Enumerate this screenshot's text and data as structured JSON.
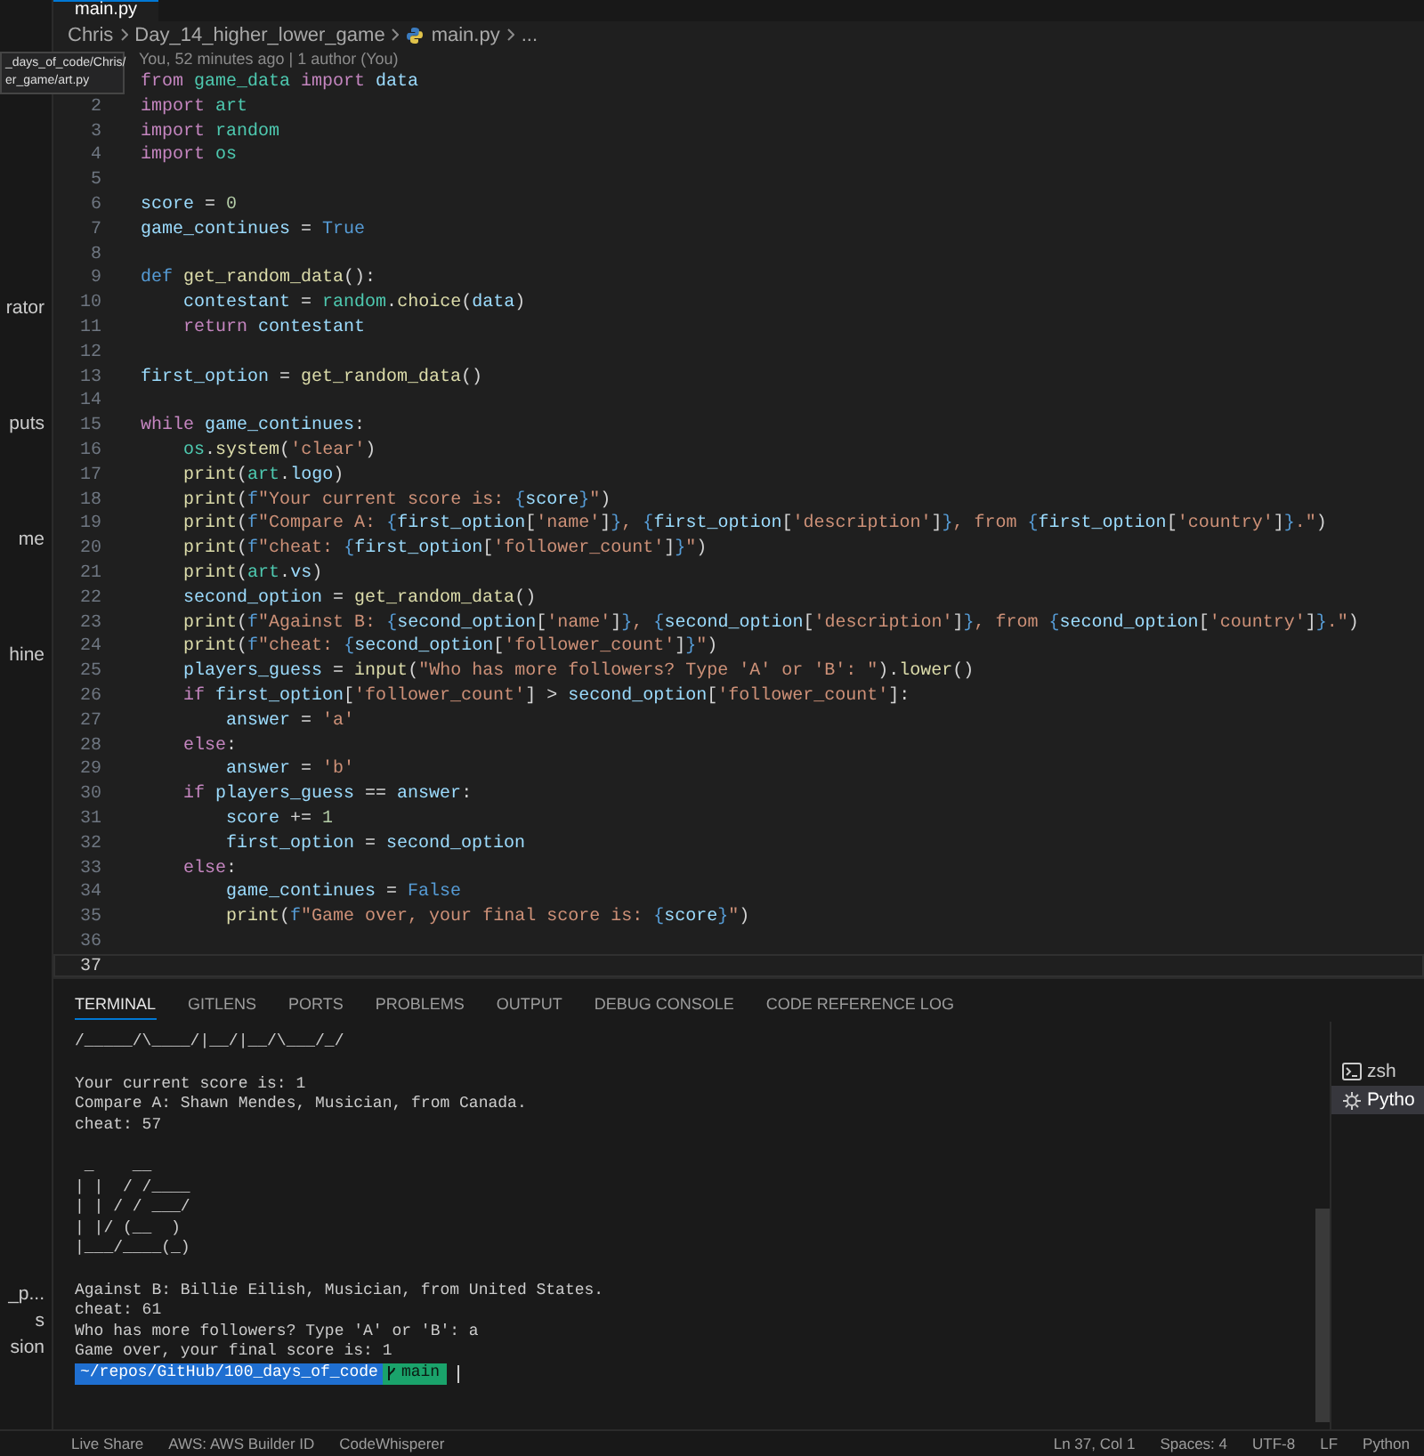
{
  "editor_tab": {
    "label": "main.py"
  },
  "breadcrumb": [
    "Chris",
    "Day_14_higher_lower_game",
    "main.py",
    "..."
  ],
  "codelens": "You, 52 minutes ago | 1 author (You)",
  "tooltip": [
    "_days_of_code/Chris/",
    "er_game/art.py"
  ],
  "sidebar": {
    "upper_items": [
      "rator",
      "puts",
      "me",
      "hine"
    ],
    "lower_items": [
      "_p...",
      "s",
      "sion"
    ]
  },
  "code_lines": [
    {
      "current": false,
      "tokens": [
        {
          "kind": "keyword",
          "text": "from "
        },
        {
          "kind": "module",
          "text": "game_data "
        },
        {
          "kind": "keyword",
          "text": "import "
        },
        {
          "kind": "variable",
          "text": "data"
        }
      ]
    },
    {
      "number": "2",
      "current": false,
      "tokens": [
        {
          "kind": "keyword",
          "text": "import "
        },
        {
          "kind": "module",
          "text": "art"
        }
      ]
    },
    {
      "number": "3",
      "current": false,
      "tokens": [
        {
          "kind": "keyword",
          "text": "import "
        },
        {
          "kind": "module",
          "text": "random"
        }
      ]
    },
    {
      "number": "4",
      "current": false,
      "tokens": [
        {
          "kind": "keyword",
          "text": "import "
        },
        {
          "kind": "module",
          "text": "os"
        }
      ]
    },
    {
      "number": "5",
      "current": false
    },
    {
      "number": "6",
      "current": false,
      "tokens": [
        {
          "kind": "variable",
          "text": "score"
        },
        {
          "kind": "plain",
          "text": " = "
        },
        {
          "kind": "number",
          "text": "0"
        }
      ]
    },
    {
      "number": "7",
      "current": false,
      "tokens": [
        {
          "kind": "variable",
          "text": "game_continues"
        },
        {
          "kind": "plain",
          "text": " = "
        },
        {
          "kind": "constant",
          "text": "True"
        }
      ]
    },
    {
      "number": "8",
      "current": false
    },
    {
      "number": "9",
      "current": false,
      "tokens": [
        {
          "kind": "constant",
          "text": "def "
        },
        {
          "kind": "function",
          "text": "get_random_data"
        },
        {
          "kind": "plain",
          "text": "():"
        }
      ]
    },
    {
      "number": "10",
      "current": false,
      "tokens": [
        {
          "kind": "variable",
          "text": "    contestant"
        },
        {
          "kind": "plain",
          "text": " = "
        },
        {
          "kind": "module",
          "text": "random"
        },
        {
          "kind": "plain",
          "text": "."
        },
        {
          "kind": "function",
          "text": "choice"
        },
        {
          "kind": "plain",
          "text": "("
        },
        {
          "kind": "variable",
          "text": "data"
        },
        {
          "kind": "plain",
          "text": ")"
        }
      ]
    },
    {
      "number": "11",
      "current": false,
      "tokens": [
        {
          "kind": "keyword",
          "text": "    return "
        },
        {
          "kind": "variable",
          "text": "contestant"
        }
      ]
    },
    {
      "number": "12",
      "current": false
    },
    {
      "number": "13",
      "current": false,
      "tokens": [
        {
          "kind": "variable",
          "text": "first_option"
        },
        {
          "kind": "plain",
          "text": " = "
        },
        {
          "kind": "function",
          "text": "get_random_data"
        },
        {
          "kind": "plain",
          "text": "()"
        }
      ]
    },
    {
      "number": "14",
      "current": false
    },
    {
      "number": "15",
      "current": false,
      "tokens": [
        {
          "kind": "keyword",
          "text": "while "
        },
        {
          "kind": "variable",
          "text": "game_continues"
        },
        {
          "kind": "plain",
          "text": ":"
        }
      ]
    },
    {
      "number": "16",
      "current": false,
      "tokens": [
        {
          "kind": "module",
          "text": "    os"
        },
        {
          "kind": "plain",
          "text": "."
        },
        {
          "kind": "function",
          "text": "system"
        },
        {
          "kind": "plain",
          "text": "("
        },
        {
          "kind": "string",
          "text": "'clear'"
        },
        {
          "kind": "plain",
          "text": ")"
        }
      ]
    },
    {
      "number": "17",
      "current": false,
      "tokens": [
        {
          "kind": "function",
          "text": "    print"
        },
        {
          "kind": "plain",
          "text": "("
        },
        {
          "kind": "module",
          "text": "art"
        },
        {
          "kind": "plain",
          "text": "."
        },
        {
          "kind": "variable",
          "text": "logo"
        },
        {
          "kind": "plain",
          "text": ")"
        }
      ]
    },
    {
      "number": "18",
      "current": false,
      "tokens": [
        {
          "kind": "function",
          "text": "    print"
        },
        {
          "kind": "plain",
          "text": "("
        },
        {
          "kind": "constant",
          "text": "f"
        },
        {
          "kind": "string",
          "text": "\"Your current score is: "
        },
        {
          "kind": "constant",
          "text": "{"
        },
        {
          "kind": "variable",
          "text": "score"
        },
        {
          "kind": "constant",
          "text": "}"
        },
        {
          "kind": "string",
          "text": "\""
        },
        {
          "kind": "plain",
          "text": ")"
        }
      ]
    },
    {
      "number": "19",
      "current": false,
      "tokens": [
        {
          "kind": "function",
          "text": "    print"
        },
        {
          "kind": "plain",
          "text": "("
        },
        {
          "kind": "constant",
          "text": "f"
        },
        {
          "kind": "string",
          "text": "\"Compare A: "
        },
        {
          "kind": "constant",
          "text": "{"
        },
        {
          "kind": "variable",
          "text": "first_option"
        },
        {
          "kind": "plain",
          "text": "["
        },
        {
          "kind": "string",
          "text": "'name'"
        },
        {
          "kind": "plain",
          "text": "]"
        },
        {
          "kind": "constant",
          "text": "}"
        },
        {
          "kind": "string",
          "text": ", "
        },
        {
          "kind": "constant",
          "text": "{"
        },
        {
          "kind": "variable",
          "text": "first_option"
        },
        {
          "kind": "plain",
          "text": "["
        },
        {
          "kind": "string",
          "text": "'description'"
        },
        {
          "kind": "plain",
          "text": "]"
        },
        {
          "kind": "constant",
          "text": "}"
        },
        {
          "kind": "string",
          "text": ", from "
        },
        {
          "kind": "constant",
          "text": "{"
        },
        {
          "kind": "variable",
          "text": "first_option"
        },
        {
          "kind": "plain",
          "text": "["
        },
        {
          "kind": "string",
          "text": "'country'"
        },
        {
          "kind": "plain",
          "text": "]"
        },
        {
          "kind": "constant",
          "text": "}"
        },
        {
          "kind": "string",
          "text": ".\""
        },
        {
          "kind": "plain",
          "text": ")"
        }
      ]
    },
    {
      "number": "20",
      "current": false,
      "tokens": [
        {
          "kind": "function",
          "text": "    print"
        },
        {
          "kind": "plain",
          "text": "("
        },
        {
          "kind": "constant",
          "text": "f"
        },
        {
          "kind": "string",
          "text": "\"cheat: "
        },
        {
          "kind": "constant",
          "text": "{"
        },
        {
          "kind": "variable",
          "text": "first_option"
        },
        {
          "kind": "plain",
          "text": "["
        },
        {
          "kind": "string",
          "text": "'follower_count'"
        },
        {
          "kind": "plain",
          "text": "]"
        },
        {
          "kind": "constant",
          "text": "}"
        },
        {
          "kind": "string",
          "text": "\""
        },
        {
          "kind": "plain",
          "text": ")"
        }
      ]
    },
    {
      "number": "21",
      "current": false,
      "tokens": [
        {
          "kind": "function",
          "text": "    print"
        },
        {
          "kind": "plain",
          "text": "("
        },
        {
          "kind": "module",
          "text": "art"
        },
        {
          "kind": "plain",
          "text": "."
        },
        {
          "kind": "variable",
          "text": "vs"
        },
        {
          "kind": "plain",
          "text": ")"
        }
      ]
    },
    {
      "number": "22",
      "current": false,
      "tokens": [
        {
          "kind": "variable",
          "text": "    second_option"
        },
        {
          "kind": "plain",
          "text": " = "
        },
        {
          "kind": "function",
          "text": "get_random_data"
        },
        {
          "kind": "plain",
          "text": "()"
        }
      ]
    },
    {
      "number": "23",
      "current": false,
      "tokens": [
        {
          "kind": "function",
          "text": "    print"
        },
        {
          "kind": "plain",
          "text": "("
        },
        {
          "kind": "constant",
          "text": "f"
        },
        {
          "kind": "string",
          "text": "\"Against B: "
        },
        {
          "kind": "constant",
          "text": "{"
        },
        {
          "kind": "variable",
          "text": "second_option"
        },
        {
          "kind": "plain",
          "text": "["
        },
        {
          "kind": "string",
          "text": "'name'"
        },
        {
          "kind": "plain",
          "text": "]"
        },
        {
          "kind": "constant",
          "text": "}"
        },
        {
          "kind": "string",
          "text": ", "
        },
        {
          "kind": "constant",
          "text": "{"
        },
        {
          "kind": "variable",
          "text": "second_option"
        },
        {
          "kind": "plain",
          "text": "["
        },
        {
          "kind": "string",
          "text": "'description'"
        },
        {
          "kind": "plain",
          "text": "]"
        },
        {
          "kind": "constant",
          "text": "}"
        },
        {
          "kind": "string",
          "text": ", from "
        },
        {
          "kind": "constant",
          "text": "{"
        },
        {
          "kind": "variable",
          "text": "second_option"
        },
        {
          "kind": "plain",
          "text": "["
        },
        {
          "kind": "string",
          "text": "'country'"
        },
        {
          "kind": "plain",
          "text": "]"
        },
        {
          "kind": "constant",
          "text": "}"
        },
        {
          "kind": "string",
          "text": ".\""
        },
        {
          "kind": "plain",
          "text": ")"
        }
      ]
    },
    {
      "number": "24",
      "current": false,
      "tokens": [
        {
          "kind": "function",
          "text": "    print"
        },
        {
          "kind": "plain",
          "text": "("
        },
        {
          "kind": "constant",
          "text": "f"
        },
        {
          "kind": "string",
          "text": "\"cheat: "
        },
        {
          "kind": "constant",
          "text": "{"
        },
        {
          "kind": "variable",
          "text": "second_option"
        },
        {
          "kind": "plain",
          "text": "["
        },
        {
          "kind": "string",
          "text": "'follower_count'"
        },
        {
          "kind": "plain",
          "text": "]"
        },
        {
          "kind": "constant",
          "text": "}"
        },
        {
          "kind": "string",
          "text": "\""
        },
        {
          "kind": "plain",
          "text": ")"
        }
      ]
    },
    {
      "number": "25",
      "current": false,
      "tokens": [
        {
          "kind": "variable",
          "text": "    players_guess"
        },
        {
          "kind": "plain",
          "text": " = "
        },
        {
          "kind": "function",
          "text": "input"
        },
        {
          "kind": "plain",
          "text": "("
        },
        {
          "kind": "string",
          "text": "\"Who has more followers? Type 'A' or 'B': \""
        },
        {
          "kind": "plain",
          "text": ")."
        },
        {
          "kind": "function",
          "text": "lower"
        },
        {
          "kind": "plain",
          "text": "()"
        }
      ]
    },
    {
      "number": "26",
      "current": false,
      "tokens": [
        {
          "kind": "keyword",
          "text": "    if "
        },
        {
          "kind": "variable",
          "text": "first_option"
        },
        {
          "kind": "plain",
          "text": "["
        },
        {
          "kind": "string",
          "text": "'follower_count'"
        },
        {
          "kind": "plain",
          "text": "] > "
        },
        {
          "kind": "variable",
          "text": "second_option"
        },
        {
          "kind": "plain",
          "text": "["
        },
        {
          "kind": "string",
          "text": "'follower_count'"
        },
        {
          "kind": "plain",
          "text": "]:"
        }
      ]
    },
    {
      "number": "27",
      "current": false,
      "tokens": [
        {
          "kind": "variable",
          "text": "        answer"
        },
        {
          "kind": "plain",
          "text": " = "
        },
        {
          "kind": "string",
          "text": "'a'"
        }
      ]
    },
    {
      "number": "28",
      "current": false,
      "tokens": [
        {
          "kind": "keyword",
          "text": "    else"
        },
        {
          "kind": "plain",
          "text": ":"
        }
      ]
    },
    {
      "number": "29",
      "current": false,
      "tokens": [
        {
          "kind": "variable",
          "text": "        answer"
        },
        {
          "kind": "plain",
          "text": " = "
        },
        {
          "kind": "string",
          "text": "'b'"
        }
      ]
    },
    {
      "number": "30",
      "current": false,
      "tokens": [
        {
          "kind": "keyword",
          "text": "    if "
        },
        {
          "kind": "variable",
          "text": "players_guess"
        },
        {
          "kind": "plain",
          "text": " == "
        },
        {
          "kind": "variable",
          "text": "answer"
        },
        {
          "kind": "plain",
          "text": ":"
        }
      ]
    },
    {
      "number": "31",
      "current": false,
      "tokens": [
        {
          "kind": "variable",
          "text": "        score"
        },
        {
          "kind": "plain",
          "text": " += "
        },
        {
          "kind": "number",
          "text": "1"
        }
      ]
    },
    {
      "number": "32",
      "current": false,
      "tokens": [
        {
          "kind": "variable",
          "text": "        first_option"
        },
        {
          "kind": "plain",
          "text": " = "
        },
        {
          "kind": "variable",
          "text": "second_option"
        }
      ]
    },
    {
      "number": "33",
      "current": false,
      "tokens": [
        {
          "kind": "keyword",
          "text": "    else"
        },
        {
          "kind": "plain",
          "text": ":"
        }
      ]
    },
    {
      "number": "34",
      "current": false,
      "tokens": [
        {
          "kind": "variable",
          "text": "        game_continues"
        },
        {
          "kind": "plain",
          "text": " = "
        },
        {
          "kind": "constant",
          "text": "False"
        }
      ]
    },
    {
      "number": "35",
      "current": false,
      "tokens": [
        {
          "kind": "function",
          "text": "        print"
        },
        {
          "kind": "plain",
          "text": "("
        },
        {
          "kind": "constant",
          "text": "f"
        },
        {
          "kind": "string",
          "text": "\"Game over, your final score is: "
        },
        {
          "kind": "constant",
          "text": "{"
        },
        {
          "kind": "variable",
          "text": "score"
        },
        {
          "kind": "constant",
          "text": "}"
        },
        {
          "kind": "string",
          "text": "\""
        },
        {
          "kind": "plain",
          "text": ")"
        }
      ]
    },
    {
      "number": "36",
      "current": false
    },
    {
      "number": "37",
      "current": true
    }
  ],
  "panel_tabs": [
    {
      "label": "TERMINAL",
      "selected": true
    },
    {
      "label": "GITLENS",
      "selected": false
    },
    {
      "label": "PORTS",
      "selected": false
    },
    {
      "label": "PROBLEMS",
      "selected": false
    },
    {
      "label": "OUTPUT",
      "selected": false
    },
    {
      "label": "DEBUG CONSOLE",
      "selected": false
    },
    {
      "label": "CODE REFERENCE LOG",
      "selected": false
    }
  ],
  "terminal_blocks": [
    [
      "/_____/\\____/|__/|__/\\___/_/"
    ],
    [
      "Your current score is: 1",
      "Compare A: Shawn Mendes, Musician, from Canada.",
      "cheat: 57"
    ],
    [
      " _    __",
      "| |  / /____",
      "| | / / ___/",
      "| |/ (__  )",
      "|___/____(_)"
    ],
    [
      "Against B: Billie Eilish, Musician, from United States.",
      "cheat: 61",
      "Who has more followers? Type 'A' or 'B': a",
      "Game over, your final score is: 1"
    ]
  ],
  "prompt": {
    "path": "~/repos/GitHub/100_days_of_code",
    "branch": "main"
  },
  "terminals": [
    {
      "kind": "shell",
      "label": "zsh",
      "selected": false
    },
    {
      "kind": "debug",
      "label": "Pytho",
      "selected": true
    }
  ],
  "status_bar": {
    "left": [
      "Live Share",
      "AWS: AWS Builder ID",
      "CodeWhisperer"
    ],
    "right": [
      "Ln 37, Col 1",
      "Spaces: 4",
      "UTF-8",
      "LF",
      "Python"
    ]
  }
}
